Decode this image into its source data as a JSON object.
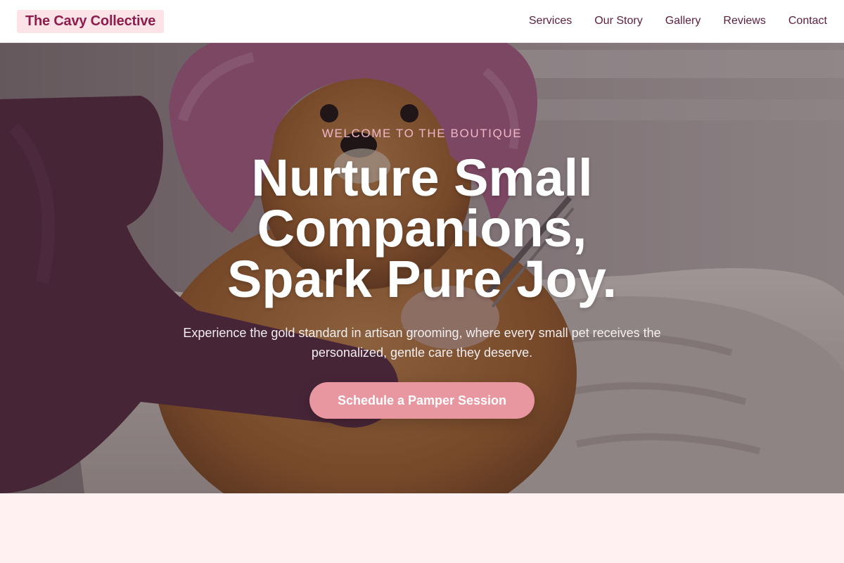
{
  "header": {
    "logo": "The Cavy Collective",
    "nav": [
      {
        "label": "Services"
      },
      {
        "label": "Our Story"
      },
      {
        "label": "Gallery"
      },
      {
        "label": "Reviews"
      },
      {
        "label": "Contact"
      }
    ]
  },
  "hero": {
    "eyebrow": "WELCOME TO THE BOUTIQUE",
    "headline_lines": [
      "Nurture Small",
      "Companions,",
      "Spark Pure Joy."
    ],
    "subtext": "Experience the gold standard in artisan grooming, where every small pet receives the personalized, gentle care they deserve.",
    "cta_label": "Schedule a Pamper Session",
    "photo_description_icon": "groomed-dog-photo"
  },
  "colors": {
    "brand": "#8f1d4c",
    "logo_bg": "#fbe3e7",
    "nav_text": "#5c1e3c",
    "eyebrow": "#f2b6c6",
    "cta_bg": "#e8969f",
    "page_bg": "#fff0f2"
  }
}
